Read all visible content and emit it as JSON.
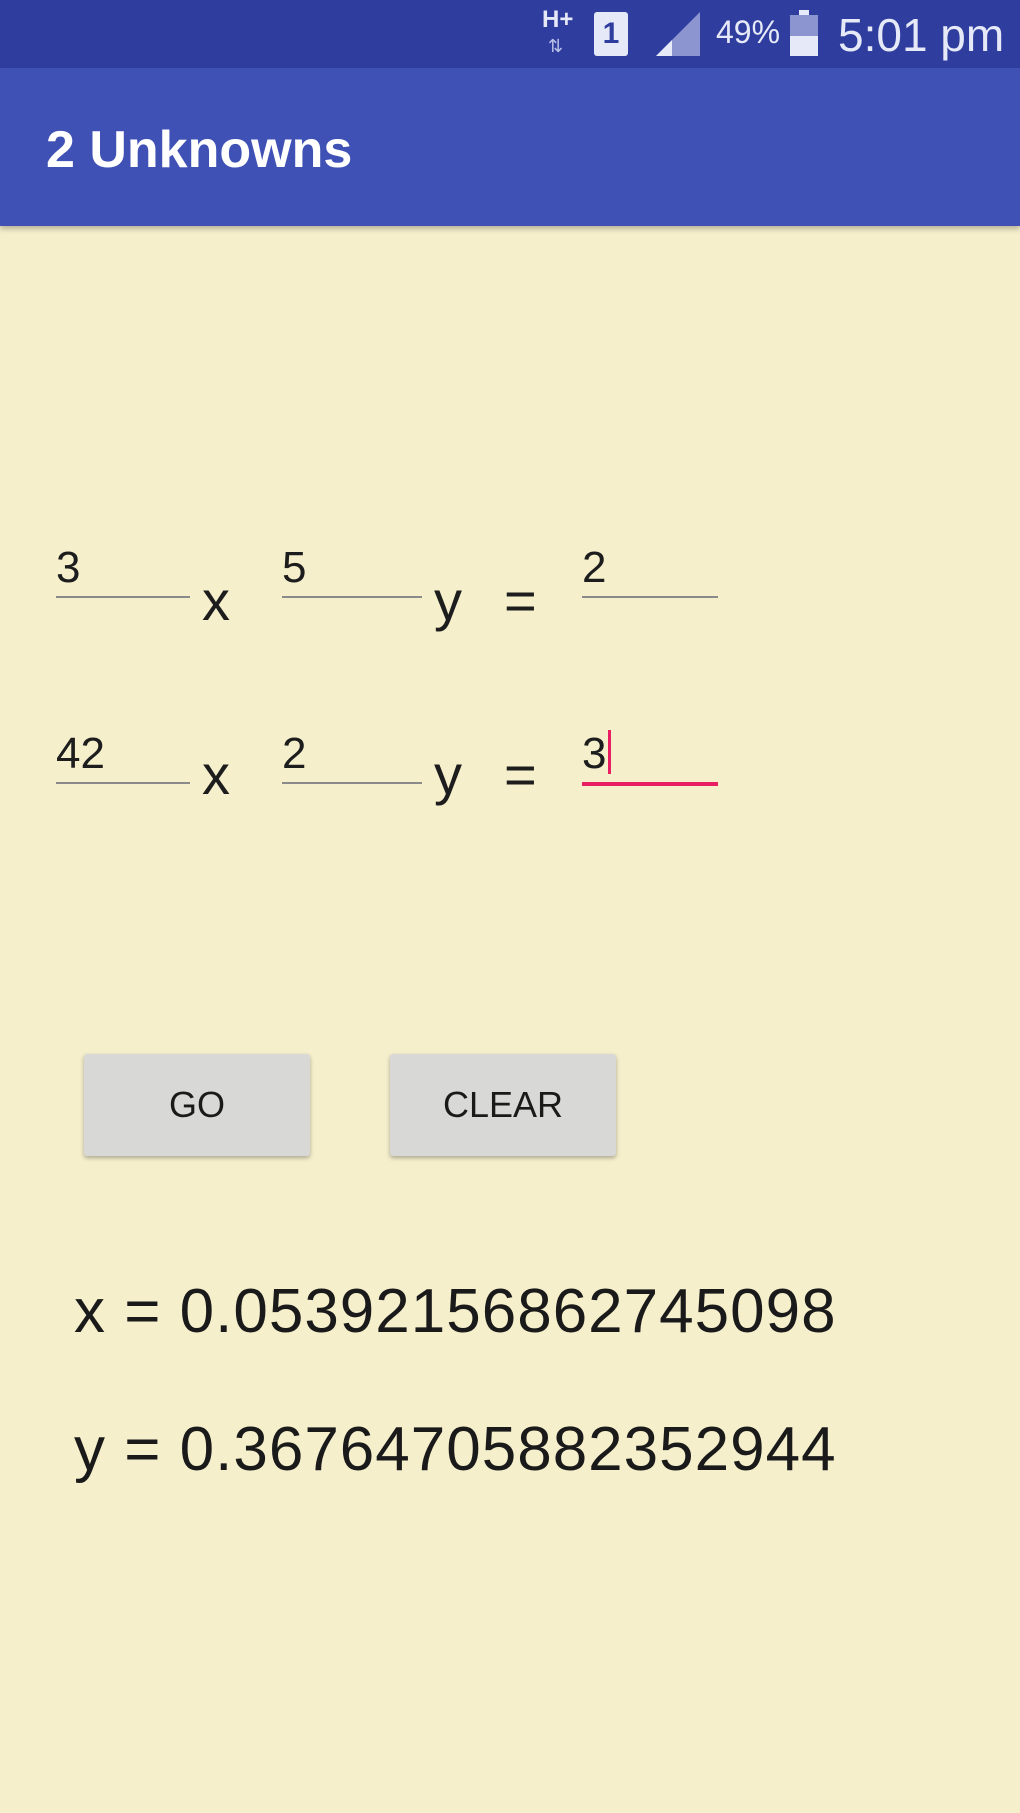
{
  "status_bar": {
    "network_type": "H+",
    "network_arrows": "⇅",
    "sim_slot": "1",
    "battery_percent": "49%",
    "battery_level": 0.49,
    "time": "5:01 pm"
  },
  "app_bar": {
    "title": "2 Unknowns"
  },
  "equations": {
    "row1": {
      "a": "3",
      "b": "5",
      "c": "2"
    },
    "row2": {
      "a": "42",
      "b": "2",
      "c": "3"
    },
    "x_symbol": "x",
    "y_symbol": "y",
    "equals_symbol": "="
  },
  "buttons": {
    "go_label": "GO",
    "clear_label": "CLEAR"
  },
  "results": {
    "x_text": "x = 0.0539215686274509​8",
    "y_text": "y = 0.36764705882352944"
  },
  "colors": {
    "status_bar": "#2F3E9E",
    "app_bar": "#3F51B5",
    "background": "#F5EFCC",
    "accent": "#E91E63"
  }
}
